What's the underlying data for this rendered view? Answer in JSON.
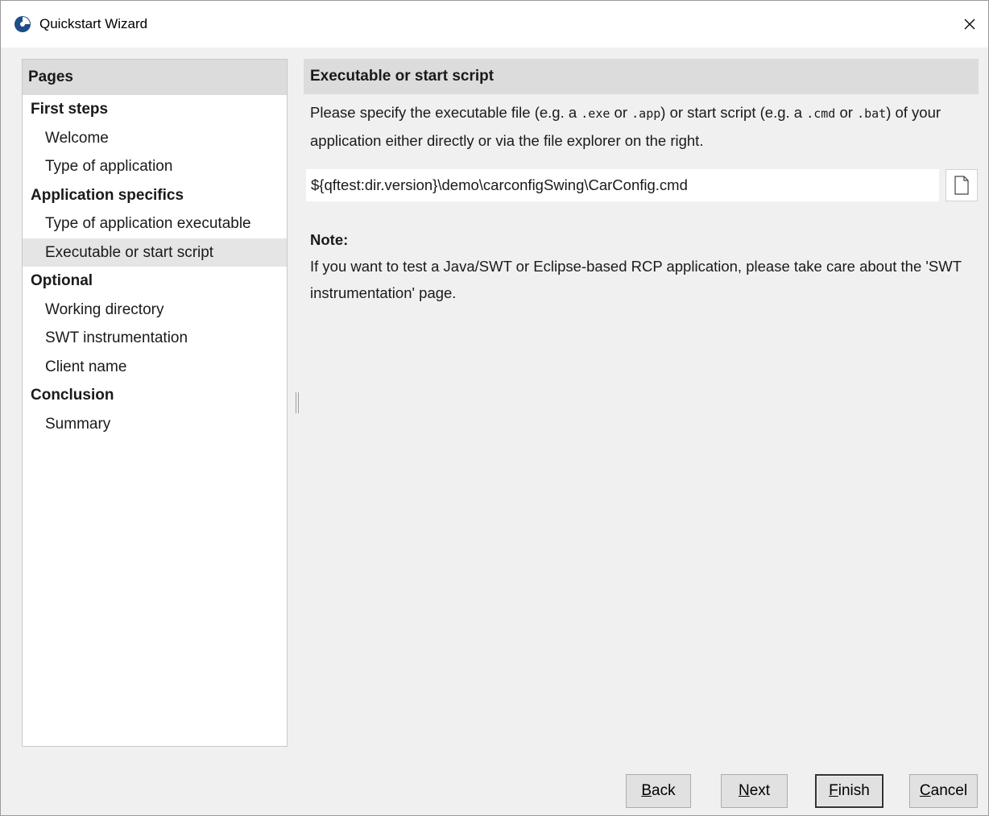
{
  "window": {
    "title": "Quickstart Wizard",
    "icon": "quickstart-app-icon",
    "close_icon": "close-icon"
  },
  "pages": {
    "header": "Pages",
    "sections": [
      {
        "label": "First steps",
        "items": [
          "Welcome",
          "Type of application"
        ]
      },
      {
        "label": "Application specifics",
        "items": [
          "Type of application executable",
          "Executable or start script"
        ]
      },
      {
        "label": "Optional",
        "items": [
          "Working directory",
          "SWT instrumentation",
          "Client name"
        ]
      },
      {
        "label": "Conclusion",
        "items": [
          "Summary"
        ]
      }
    ],
    "selected": "Executable or start script"
  },
  "content": {
    "header": "Executable or start script",
    "description": {
      "p1": "Please specify the executable file (e.g. a ",
      "code1": ".exe",
      "p2": " or ",
      "code2": ".app",
      "p3": ") or start script (e.g. a ",
      "code3": ".cmd",
      "p4": " or ",
      "code4": ".bat",
      "p5": ") of your application either directly or via the file explorer on the right."
    },
    "path_value": "${qftest:dir.version}\\demo\\carconfigSwing\\CarConfig.cmd",
    "browse_icon": "file-icon",
    "note_title": "Note:",
    "note_text": "If you want to test a Java/SWT or Eclipse-based RCP application, please take care about the 'SWT instrumentation' page."
  },
  "buttons": {
    "back": {
      "mnemonic": "B",
      "rest": "ack"
    },
    "next": {
      "mnemonic": "N",
      "rest": "ext"
    },
    "finish": {
      "mnemonic": "F",
      "rest": "inish"
    },
    "cancel": {
      "mnemonic": "C",
      "rest": "ancel"
    }
  },
  "colors": {
    "header_bg": "#dcdcdc",
    "selected_bg": "#e5e5e5",
    "window_bg": "#f0f0f0",
    "icon_blue": "#1e4c8a"
  }
}
